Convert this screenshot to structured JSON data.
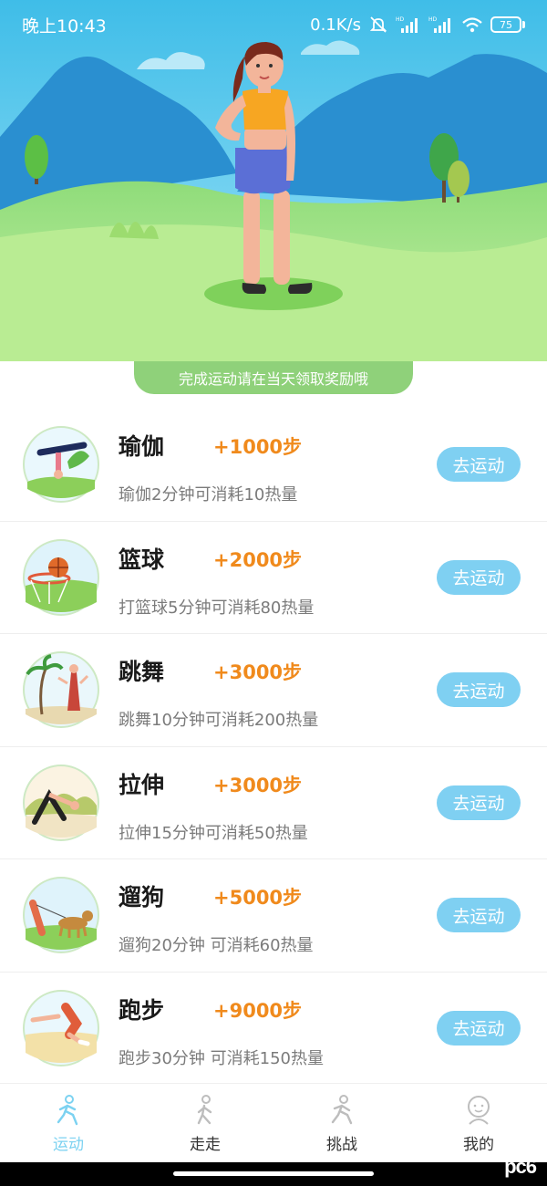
{
  "status_bar": {
    "time": "晚上10:43",
    "network_speed": "0.1K/s",
    "battery": "75"
  },
  "banner": {
    "text": "完成运动请在当天领取奖励哦"
  },
  "activities": [
    {
      "name": "瑜伽",
      "steps": "+1000步",
      "desc": "瑜伽2分钟可消耗10热量",
      "button": "去运动",
      "image": "yoga-image"
    },
    {
      "name": "篮球",
      "steps": "+2000步",
      "desc": "打篮球5分钟可消耗80热量",
      "button": "去运动",
      "image": "basketball-image"
    },
    {
      "name": "跳舞",
      "steps": "+3000步",
      "desc": "跳舞10分钟可消耗200热量",
      "button": "去运动",
      "image": "dance-image"
    },
    {
      "name": "拉伸",
      "steps": "+3000步",
      "desc": "拉伸15分钟可消耗50热量",
      "button": "去运动",
      "image": "stretch-image"
    },
    {
      "name": "遛狗",
      "steps": "+5000步",
      "desc": "遛狗20分钟 可消耗60热量",
      "button": "去运动",
      "image": "dog-walking-image"
    },
    {
      "name": "跑步",
      "steps": "+9000步",
      "desc": "跑步30分钟 可消耗150热量",
      "button": "去运动",
      "image": "running-image"
    }
  ],
  "bottom_nav": {
    "active": "运动",
    "tabs": [
      {
        "label": "运动",
        "icon": "exercise-icon"
      },
      {
        "label": "走走",
        "icon": "walk-icon"
      },
      {
        "label": "挑战",
        "icon": "challenge-icon"
      },
      {
        "label": "我的",
        "icon": "profile-icon"
      }
    ]
  },
  "watermark": "pc6",
  "colors": {
    "accent": "#7fd0f2",
    "steps": "#f08a1c",
    "banner": "#8fd17a"
  }
}
